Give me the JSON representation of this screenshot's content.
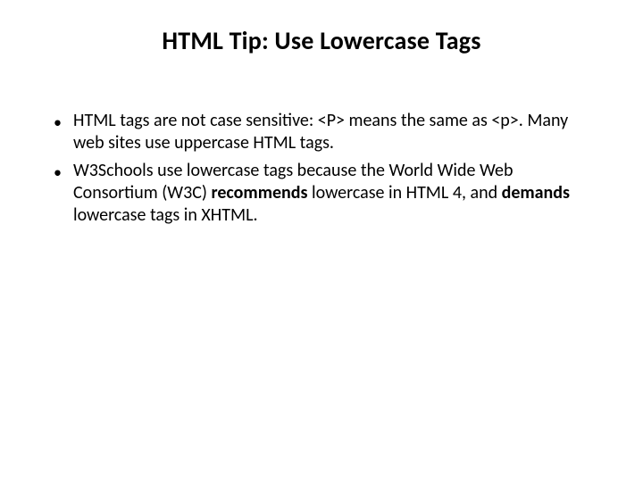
{
  "slide": {
    "title": "HTML Tip: Use Lowercase Tags",
    "bullets": [
      {
        "parts": [
          {
            "text": "HTML tags are not case sensitive: <P> means the same as <p>. Many web sites use uppercase HTML tags.",
            "bold": false
          }
        ]
      },
      {
        "parts": [
          {
            "text": "W3Schools use lowercase tags because the World Wide Web Consortium (W3C) ",
            "bold": false
          },
          {
            "text": "recommends",
            "bold": true
          },
          {
            "text": " lowercase in HTML 4, and ",
            "bold": false
          },
          {
            "text": "demands",
            "bold": true
          },
          {
            "text": " lowercase tags in XHTML.",
            "bold": false
          }
        ]
      }
    ]
  }
}
